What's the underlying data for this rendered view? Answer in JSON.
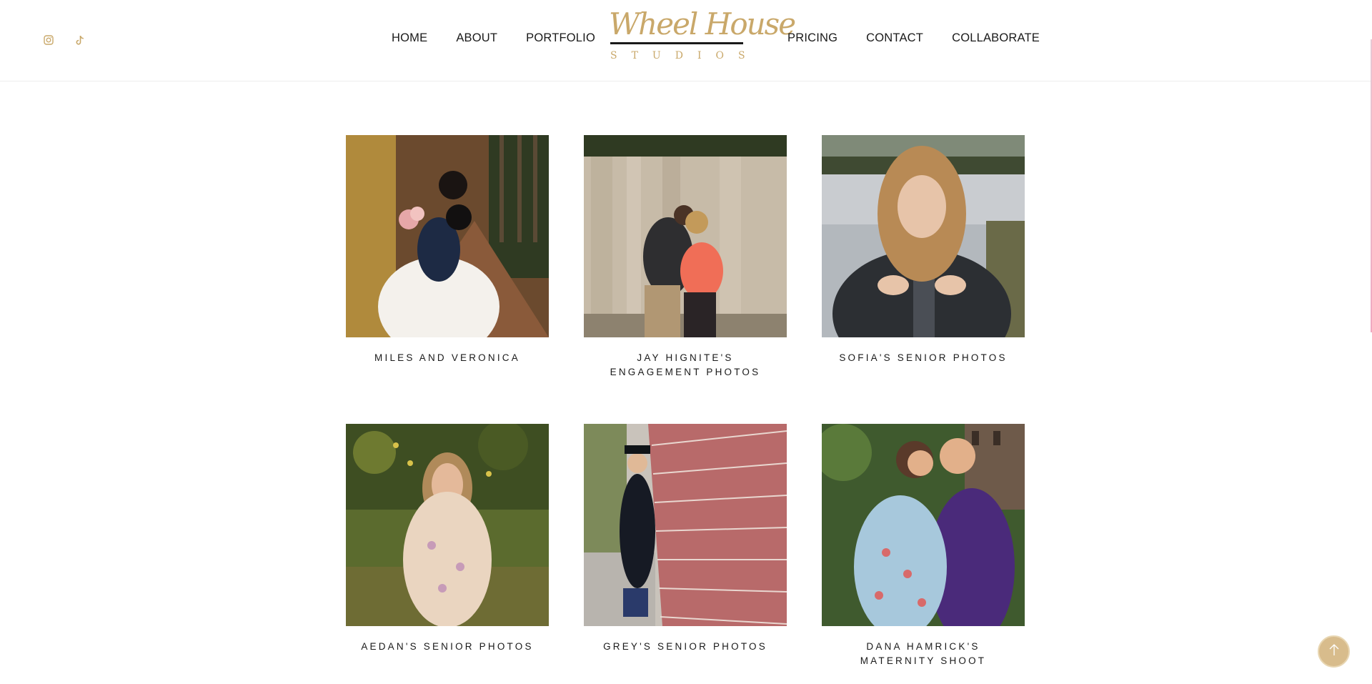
{
  "header": {
    "social": [
      {
        "icon": "instagram-icon",
        "label": "Instagram"
      },
      {
        "icon": "tiktok-icon",
        "label": "TikTok"
      }
    ],
    "nav_left": [
      {
        "label": "HOME"
      },
      {
        "label": "ABOUT"
      },
      {
        "label": "PORTFOLIO"
      }
    ],
    "nav_right": [
      {
        "label": "PRICING"
      },
      {
        "label": "CONTACT"
      },
      {
        "label": "COLLABORATE"
      }
    ],
    "logo": {
      "script": "Wheel House",
      "sub": "STUDIOS"
    }
  },
  "gallery": {
    "items": [
      {
        "title": "MILES AND VERONICA"
      },
      {
        "title": "JAY HIGNITE'S ENGAGEMENT PHOTOS"
      },
      {
        "title": "SOFIA'S SENIOR PHOTOS"
      },
      {
        "title": "AEDAN'S SENIOR PHOTOS"
      },
      {
        "title": "GREY'S SENIOR PHOTOS"
      },
      {
        "title": "DANA HAMRICK'S MATERNITY SHOOT"
      }
    ]
  },
  "colors": {
    "accent_gold": "#c9a86a",
    "back_to_top": "#d8bc8c",
    "text": "#1a1a1a"
  },
  "back_to_top": {
    "icon": "arrow-up-icon"
  }
}
